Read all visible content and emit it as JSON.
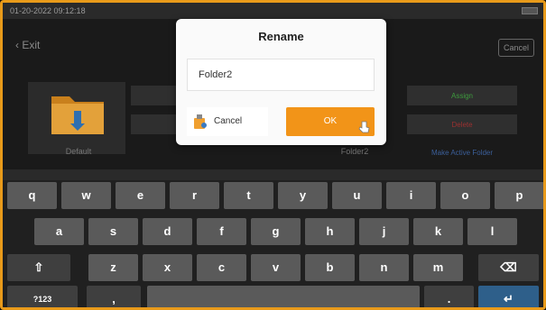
{
  "status": {
    "datetime": "01-20-2022 09:12:18"
  },
  "header": {
    "exit_label": "Exit",
    "cancel_label": "Cancel"
  },
  "folders": {
    "default_label": "Default",
    "folder2_label": "Folder2",
    "actions": {
      "assign": "Assign",
      "delete": "Delete",
      "make_active": "Make Active Folder"
    }
  },
  "dialog": {
    "title": "Rename",
    "input_value": "Folder2",
    "cancel_label": "Cancel",
    "ok_label": "OK"
  },
  "keyboard": {
    "row1": [
      "q",
      "w",
      "e",
      "r",
      "t",
      "y",
      "u",
      "i",
      "o",
      "p"
    ],
    "row2": [
      "a",
      "s",
      "d",
      "f",
      "g",
      "h",
      "j",
      "k",
      "l"
    ],
    "row3": [
      "z",
      "x",
      "c",
      "v",
      "b",
      "n",
      "m"
    ],
    "symbols_label": "?123",
    "comma": ",",
    "period": "."
  },
  "colors": {
    "accent": "#f29418",
    "frame": "#e89a1a",
    "enter": "#2e5f8a"
  }
}
